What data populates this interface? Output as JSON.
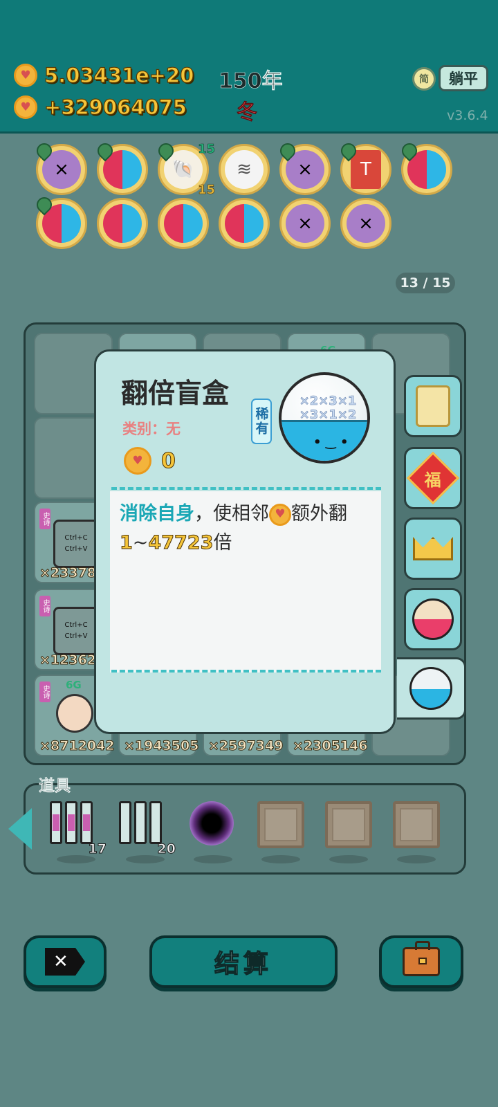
{
  "header": {
    "money_total": "5.03431e+20",
    "money_gain": "+329064075",
    "year": "150年",
    "season": "冬",
    "simplify_icon_text": "简",
    "flat_button": "躺平",
    "version": "v3.6.4"
  },
  "relics": [
    {
      "icon": "pinned-multiplier-relic",
      "glyph": "×"
    },
    {
      "icon": "pinned-dual-bowl-relic",
      "glyph": "◐"
    },
    {
      "icon": "pinned-shell-relic",
      "glyph": "🐚",
      "top_count": "15",
      "bottom_count": "15"
    },
    {
      "icon": "skirt-relic",
      "glyph": "≋"
    },
    {
      "icon": "pinned-multiplier-relic",
      "glyph": "×"
    },
    {
      "icon": "pinned-time-magazine-relic",
      "glyph": "T"
    },
    {
      "icon": "pinned-dual-bowl-relic",
      "glyph": "◐"
    },
    {
      "icon": "pinned-dual-bowl-relic",
      "glyph": "◐"
    },
    {
      "icon": "dual-bowl-relic",
      "glyph": "◐"
    },
    {
      "icon": "dual-bowl-relic",
      "glyph": "◐"
    },
    {
      "icon": "dual-bowl-relic",
      "glyph": "◐"
    },
    {
      "icon": "multiplier-relic",
      "glyph": "×"
    },
    {
      "icon": "multiplier-relic",
      "glyph": "×"
    }
  ],
  "page_indicator": "13 / 15",
  "board": {
    "cells": [
      {
        "mult": "×23378",
        "tag": "史诗",
        "content": "Ctrl+C\nCtrl+V"
      },
      {
        "mult": "×12362",
        "tag": "史诗",
        "content": "Ctrl+C\nCtrl+V"
      },
      {
        "mult": "×8712042",
        "tag": "史诗",
        "badge": "6G"
      },
      {
        "mult": "×1943505"
      },
      {
        "mult": "×2597349"
      },
      {
        "mult": "×2305146"
      }
    ],
    "top_badge": "6G"
  },
  "popup": {
    "title": "翻倍盲盒",
    "category": "类别：无",
    "rarity": "稀有",
    "coin_value": "0",
    "bowl_numbers": "×2×3×1 ×3×1×2",
    "desc_highlight": "消除自身",
    "desc_part1": "，使相邻",
    "desc_part2": "额外翻",
    "desc_min": "1",
    "desc_sep": "~",
    "desc_max": "47723",
    "desc_end": "倍"
  },
  "side_tabs": [
    {
      "name": "claw-machine-tab",
      "glyph": "🎰"
    },
    {
      "name": "fortune-tab",
      "glyph": "福"
    },
    {
      "name": "crown-tab",
      "glyph": "👑"
    },
    {
      "name": "pink-bowl-tab",
      "glyph": "●"
    },
    {
      "name": "blind-box-tab",
      "glyph": "●"
    }
  ],
  "items": {
    "label": "道具",
    "slots": [
      {
        "name": "epic-cards-item",
        "qty": "17"
      },
      {
        "name": "empty-cards-item",
        "qty": "20"
      },
      {
        "name": "black-hole-item",
        "qty": ""
      },
      {
        "name": "empty-slot",
        "qty": ""
      },
      {
        "name": "empty-slot",
        "qty": ""
      },
      {
        "name": "empty-slot",
        "qty": ""
      }
    ]
  },
  "bottom": {
    "settle_label": "结算"
  },
  "colors": {
    "top_bar": "#0f7a78",
    "background": "#5e8684",
    "coin": "#f3b43c",
    "accent_teal": "#1aa7b5",
    "season_red": "#e8434c"
  }
}
